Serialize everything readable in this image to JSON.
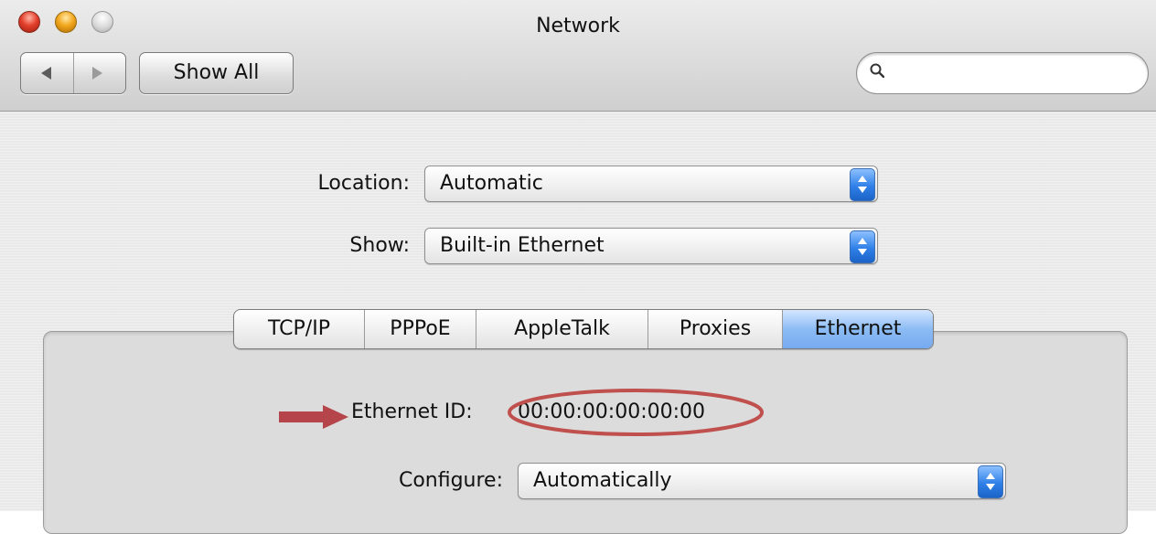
{
  "window": {
    "title": "Network"
  },
  "toolbar": {
    "back_icon": "left-arrow",
    "forward_icon": "right-arrow",
    "show_all_label": "Show All",
    "search_placeholder": ""
  },
  "location": {
    "label": "Location:",
    "value": "Automatic"
  },
  "show": {
    "label": "Show:",
    "value": "Built-in Ethernet"
  },
  "tabs": [
    {
      "label": "TCP/IP",
      "active": false
    },
    {
      "label": "PPPoE",
      "active": false
    },
    {
      "label": "AppleTalk",
      "active": false
    },
    {
      "label": "Proxies",
      "active": false
    },
    {
      "label": "Ethernet",
      "active": true
    }
  ],
  "ethernet": {
    "id_label": "Ethernet ID:",
    "id_value": "00:00:00:00:00:00"
  },
  "configure": {
    "label": "Configure:",
    "value": "Automatically"
  },
  "annotations": {
    "arrow_color": "#b5454a",
    "oval_color": "#c0504d"
  },
  "colors": {
    "accent": "#3a86e8",
    "tab_active": "#8cbcf4"
  }
}
